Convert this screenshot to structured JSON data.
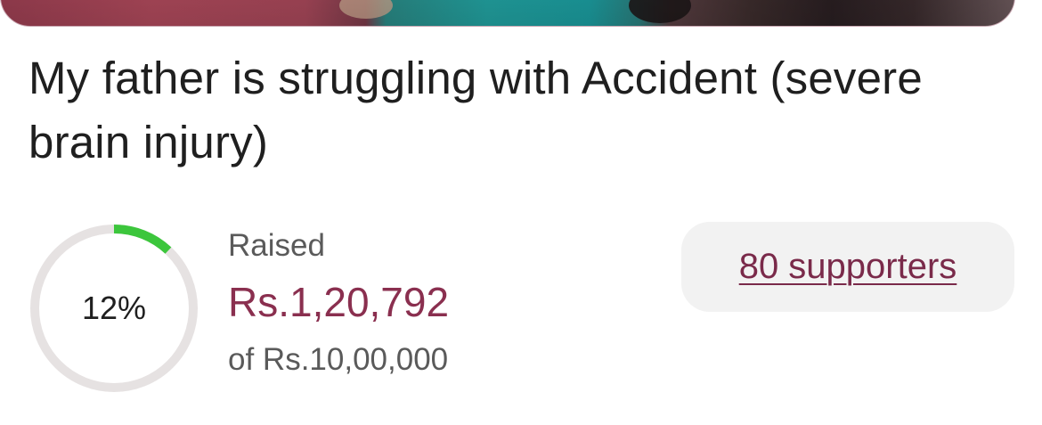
{
  "campaign": {
    "title": "My father is struggling with Accident (severe brain injury)"
  },
  "progress": {
    "percent_label": "12%",
    "fraction": 0.12,
    "fill_color": "#3cc63c",
    "track_color": "#e6e2e2"
  },
  "funding": {
    "raised_label": "Raised",
    "raised_amount": "Rs.1,20,792",
    "goal_text": "of Rs.10,00,000",
    "amount_color": "#8a2f4f"
  },
  "supporters": {
    "label": "80 supporters"
  }
}
